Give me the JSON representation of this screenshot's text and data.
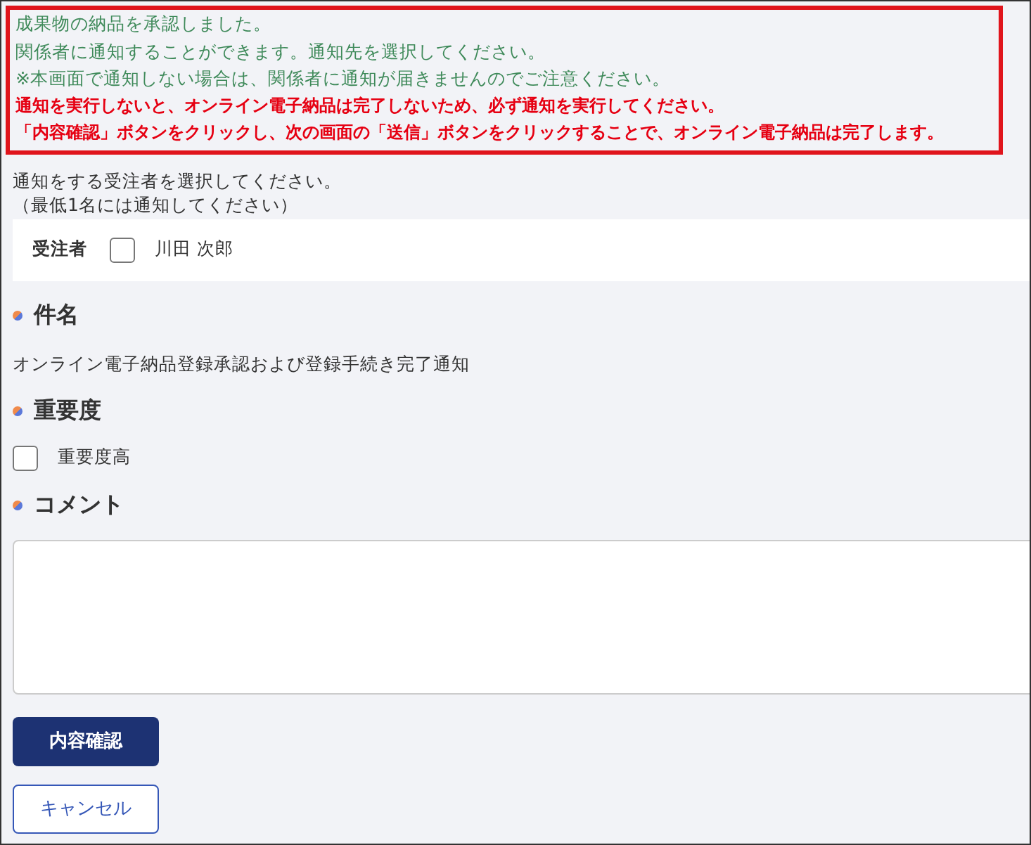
{
  "messages": [
    {
      "kind": "info",
      "text": "成果物の納品を承認しました。"
    },
    {
      "kind": "info",
      "text": "関係者に通知することができます。通知先を選択してください。"
    },
    {
      "kind": "info",
      "text": "※本画面で通知しない場合は、関係者に通知が届きませんのでご注意ください。"
    },
    {
      "kind": "warning",
      "text": "通知を実行しないと、オンライン電子納品は完了しないため、必ず通知を実行してください。"
    },
    {
      "kind": "warning",
      "text": "「内容確認」ボタンをクリックし、次の画面の「送信」ボタンをクリックすることで、オンライン電子納品は完了します。"
    }
  ],
  "recipient_intro": [
    "通知をする受注者を選択してください。",
    "（最低1名には通知してください）"
  ],
  "recipients": {
    "label": "受注者",
    "items": [
      {
        "name": "川田 次郎",
        "checked": false
      }
    ]
  },
  "subject": {
    "heading": "件名",
    "value": "オンライン電子納品登録承認および登録手続き完了通知"
  },
  "importance": {
    "heading": "重要度",
    "label": "重要度高",
    "checked": false
  },
  "comment": {
    "heading": "コメント"
  },
  "buttons": [
    {
      "kind": "primary",
      "label": "内容確認"
    },
    {
      "kind": "secondary",
      "label": "キャンセル"
    }
  ]
}
